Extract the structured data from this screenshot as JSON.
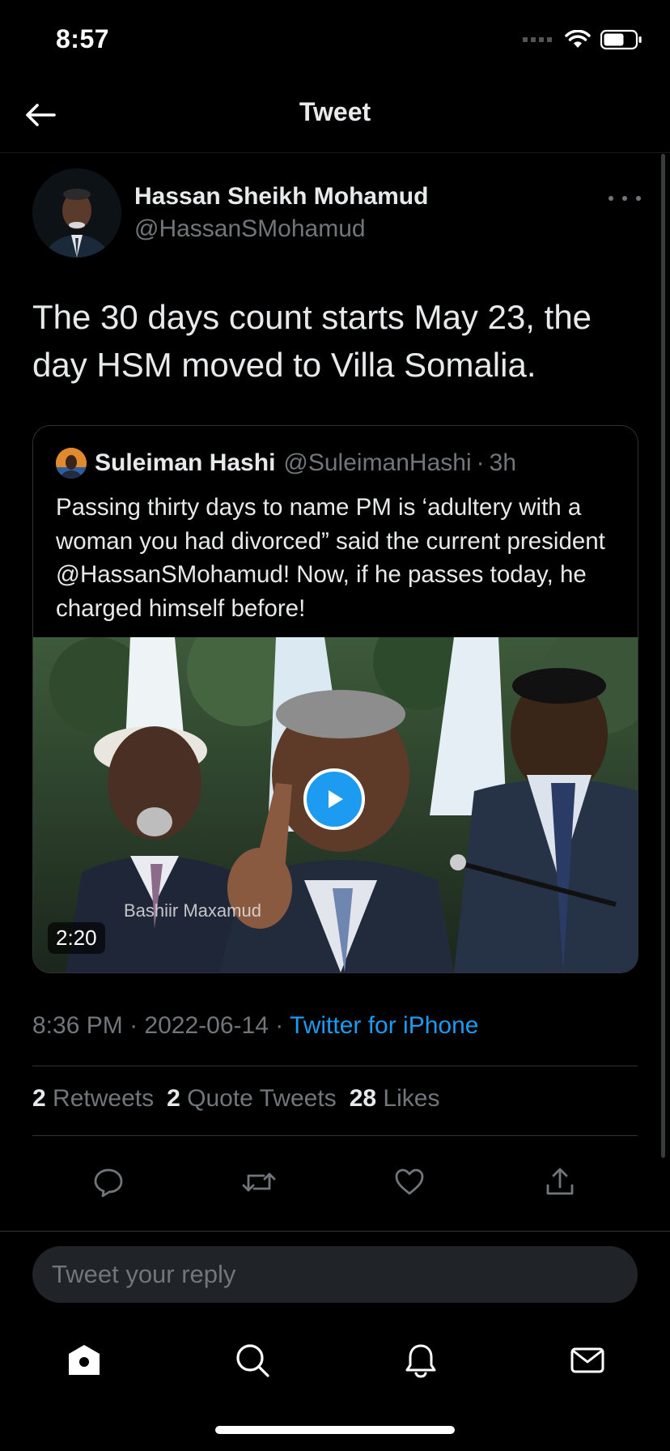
{
  "status_bar": {
    "time": "8:57"
  },
  "nav": {
    "title": "Tweet",
    "back_icon": "arrow-left-icon"
  },
  "tweet": {
    "author": {
      "name": "Hassan Sheikh Mohamud",
      "handle": "@HassanSMohamud"
    },
    "text": "The 30 days count starts May 23, the day HSM moved to Villa Somalia.",
    "quote": {
      "author_name": "Suleiman Hashi",
      "author_handle": "@SuleimanHashi",
      "separator": "·",
      "time": "3h",
      "text": "Passing thirty days to name PM is ‘adultery with a woman you had divorced” said the current president @HassanSMohamud! Now, if he passes today, he charged himself before!",
      "video": {
        "duration": "2:20",
        "caption_text": "Bashiir Maxamud"
      }
    },
    "meta": {
      "time": "8:36 PM",
      "sep1": "·",
      "date": "2022-06-14",
      "sep2": "·",
      "client": "Twitter for iPhone"
    },
    "stats": {
      "retweets_count": "2",
      "retweets_label": "Retweets",
      "quotes_count": "2",
      "quotes_label": "Quote Tweets",
      "likes_count": "28",
      "likes_label": "Likes"
    }
  },
  "reply": {
    "placeholder": "Tweet your reply"
  },
  "tab_bar": {
    "items": [
      "home-icon",
      "search-icon",
      "notifications-icon",
      "messages-icon"
    ]
  },
  "colors": {
    "background": "#000000",
    "accent": "#1d9bf0",
    "text_primary": "#e7e9ea",
    "text_secondary": "#71767b"
  }
}
